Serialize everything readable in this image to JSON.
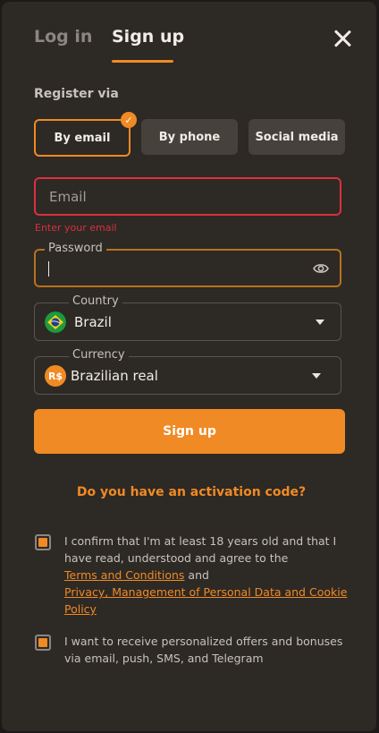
{
  "tabs": {
    "login": "Log in",
    "signup": "Sign up"
  },
  "register_via": "Register via",
  "methods": {
    "email": "By email",
    "phone": "By phone",
    "social": "Social media"
  },
  "email": {
    "placeholder": "Email",
    "error": "Enter your email"
  },
  "password": {
    "label": "Password",
    "value": ""
  },
  "country": {
    "label": "Country",
    "value": "Brazil",
    "flag": "brazil-flag"
  },
  "currency": {
    "label": "Currency",
    "value": "Brazilian real",
    "symbol": "R$"
  },
  "signup_button": "Sign up",
  "activation_link": "Do you have an activation code?",
  "consent": {
    "age_text": "I confirm that I'm at least 18 years old and that I have read, understood and agree to the",
    "terms_link": "Terms and Conditions",
    "and": "and",
    "privacy_link": "Privacy, Management of Personal Data and Cookie Policy",
    "offers_text": "I want to receive personalized offers and bonuses via email, push, SMS, and Telegram",
    "age_checked": true,
    "offers_checked": true
  },
  "colors": {
    "accent": "#f08a24",
    "error": "#d9303f",
    "panel": "#2d2925"
  }
}
